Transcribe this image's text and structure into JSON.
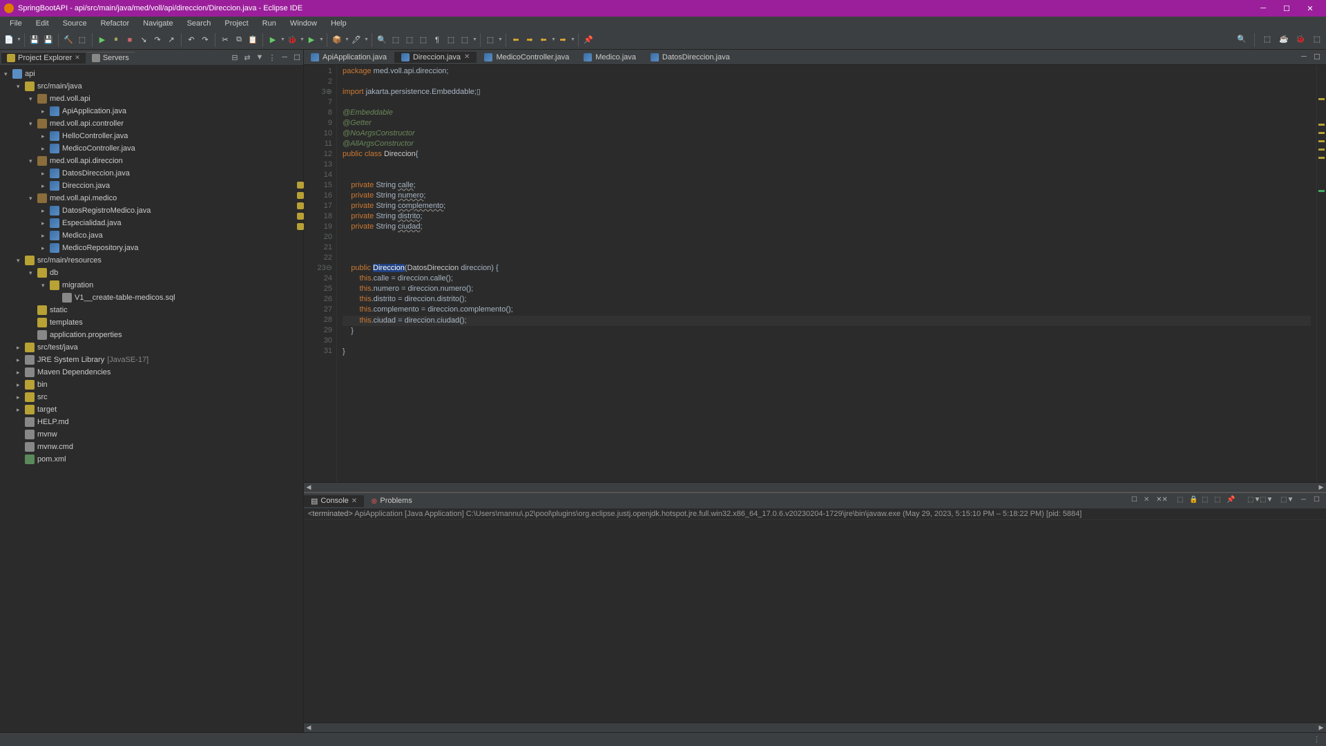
{
  "window": {
    "title": "SpringBootAPI - api/src/main/java/med/voll/api/direccion/Direccion.java - Eclipse IDE"
  },
  "menus": [
    "File",
    "Edit",
    "Source",
    "Refactor",
    "Navigate",
    "Search",
    "Project",
    "Run",
    "Window",
    "Help"
  ],
  "explorer": {
    "tab1": "Project Explorer",
    "tab2": "Servers",
    "tree": [
      {
        "d": 0,
        "exp": "v",
        "ic": "proj",
        "label": "api"
      },
      {
        "d": 1,
        "exp": "v",
        "ic": "folder",
        "label": "src/main/java"
      },
      {
        "d": 2,
        "exp": "v",
        "ic": "pkg",
        "label": "med.voll.api"
      },
      {
        "d": 3,
        "exp": ">",
        "ic": "java",
        "label": "ApiApplication.java"
      },
      {
        "d": 2,
        "exp": "v",
        "ic": "pkg",
        "label": "med.voll.api.controller"
      },
      {
        "d": 3,
        "exp": ">",
        "ic": "java",
        "label": "HelloController.java"
      },
      {
        "d": 3,
        "exp": ">",
        "ic": "java",
        "label": "MedicoController.java"
      },
      {
        "d": 2,
        "exp": "v",
        "ic": "pkg",
        "label": "med.voll.api.direccion"
      },
      {
        "d": 3,
        "exp": ">",
        "ic": "java",
        "label": "DatosDireccion.java"
      },
      {
        "d": 3,
        "exp": ">",
        "ic": "java",
        "label": "Direccion.java"
      },
      {
        "d": 2,
        "exp": "v",
        "ic": "pkg",
        "label": "med.voll.api.medico"
      },
      {
        "d": 3,
        "exp": ">",
        "ic": "java",
        "label": "DatosRegistroMedico.java"
      },
      {
        "d": 3,
        "exp": ">",
        "ic": "java",
        "label": "Especialidad.java"
      },
      {
        "d": 3,
        "exp": ">",
        "ic": "java",
        "label": "Medico.java"
      },
      {
        "d": 3,
        "exp": ">",
        "ic": "java",
        "label": "MedicoRepository.java"
      },
      {
        "d": 1,
        "exp": "v",
        "ic": "folder",
        "label": "src/main/resources"
      },
      {
        "d": 2,
        "exp": "v",
        "ic": "folder",
        "label": "db"
      },
      {
        "d": 3,
        "exp": "v",
        "ic": "folder",
        "label": "migration"
      },
      {
        "d": 4,
        "exp": "",
        "ic": "generic",
        "label": "V1__create-table-medicos.sql"
      },
      {
        "d": 2,
        "exp": "",
        "ic": "folder",
        "label": "static"
      },
      {
        "d": 2,
        "exp": "",
        "ic": "folder",
        "label": "templates"
      },
      {
        "d": 2,
        "exp": "",
        "ic": "generic",
        "label": "application.properties"
      },
      {
        "d": 1,
        "exp": ">",
        "ic": "folder",
        "label": "src/test/java"
      },
      {
        "d": 1,
        "exp": ">",
        "ic": "generic",
        "label": "JRE System Library",
        "suffix": "[JavaSE-17]"
      },
      {
        "d": 1,
        "exp": ">",
        "ic": "generic",
        "label": "Maven Dependencies"
      },
      {
        "d": 1,
        "exp": ">",
        "ic": "folder",
        "label": "bin"
      },
      {
        "d": 1,
        "exp": ">",
        "ic": "folder",
        "label": "src"
      },
      {
        "d": 1,
        "exp": ">",
        "ic": "folder",
        "label": "target"
      },
      {
        "d": 1,
        "exp": "",
        "ic": "generic",
        "label": "HELP.md"
      },
      {
        "d": 1,
        "exp": "",
        "ic": "generic",
        "label": "mvnw"
      },
      {
        "d": 1,
        "exp": "",
        "ic": "generic",
        "label": "mvnw.cmd"
      },
      {
        "d": 1,
        "exp": "",
        "ic": "xml",
        "label": "pom.xml"
      }
    ]
  },
  "editor_tabs": [
    {
      "label": "ApiApplication.java",
      "active": false,
      "close": false
    },
    {
      "label": "Direccion.java",
      "active": true,
      "close": true
    },
    {
      "label": "MedicoController.java",
      "active": false,
      "close": false
    },
    {
      "label": "Medico.java",
      "active": false,
      "close": false
    },
    {
      "label": "DatosDireccion.java",
      "active": false,
      "close": false
    }
  ],
  "code": {
    "lines": [
      {
        "n": "1",
        "html": "<span class='kw'>package</span> med.voll.api.direccion;"
      },
      {
        "n": "2",
        "html": ""
      },
      {
        "n": "3⊕",
        "html": "<span class='kw'>import</span> jakarta.persistence.Embeddable;▯"
      },
      {
        "n": "7",
        "html": ""
      },
      {
        "n": "8",
        "html": "<span class='gr'>@Embeddable</span>"
      },
      {
        "n": "9",
        "html": "<span class='gr'>@Getter</span>"
      },
      {
        "n": "10",
        "html": "<span class='gr'>@NoArgsConstructor</span>"
      },
      {
        "n": "11",
        "html": "<span class='gr'>@AllArgsConstructor</span>"
      },
      {
        "n": "12",
        "html": "<span class='kw'>public</span> <span class='kw'>class</span> <span class='cls'>Direccion</span>{"
      },
      {
        "n": "13",
        "html": ""
      },
      {
        "n": "14",
        "html": ""
      },
      {
        "n": "15",
        "warn": true,
        "html": "    <span class='kw'>private</span> String <span class='und'>calle</span>;"
      },
      {
        "n": "16",
        "warn": true,
        "html": "    <span class='kw'>private</span> String <span class='und'>numero</span>;"
      },
      {
        "n": "17",
        "warn": true,
        "html": "    <span class='kw'>private</span> String <span class='und'>complemento</span>;"
      },
      {
        "n": "18",
        "warn": true,
        "html": "    <span class='kw'>private</span> String <span class='und'>distrito</span>;"
      },
      {
        "n": "19",
        "warn": true,
        "html": "    <span class='kw'>private</span> String <span class='und'>ciudad</span>;"
      },
      {
        "n": "20",
        "html": ""
      },
      {
        "n": "21",
        "html": ""
      },
      {
        "n": "22",
        "html": ""
      },
      {
        "n": "23⊖",
        "html": "    <span class='kw'>public</span> <span class='hl'>Direccion</span>(<span class='cls'>DatosDireccion</span> direccion) {"
      },
      {
        "n": "24",
        "html": "        <span class='this'>this</span>.calle = direccion.calle();"
      },
      {
        "n": "25",
        "html": "        <span class='this'>this</span>.numero = direccion.numero();"
      },
      {
        "n": "26",
        "html": "        <span class='this'>this</span>.distrito = direccion.distrito();"
      },
      {
        "n": "27",
        "html": "        <span class='this'>this</span>.complemento = direccion.complemento();"
      },
      {
        "n": "28",
        "cur": true,
        "html": "        <span class='this'>this</span>.ciudad = direccion.ciudad();"
      },
      {
        "n": "29",
        "html": "    }"
      },
      {
        "n": "30",
        "html": ""
      },
      {
        "n": "31",
        "html": "}"
      }
    ]
  },
  "console": {
    "tab1": "Console",
    "tab2": "Problems",
    "header_prefix": "<terminated>",
    "header_text": "ApiApplication [Java Application] C:\\Users\\mannu\\.p2\\pool\\plugins\\org.eclipse.justj.openjdk.hotspot.jre.full.win32.x86_64_17.0.6.v20230204-1729\\jre\\bin\\javaw.exe  (May 29, 2023, 5:15:10 PM – 5:18:22 PM) [pid: 5884]"
  }
}
